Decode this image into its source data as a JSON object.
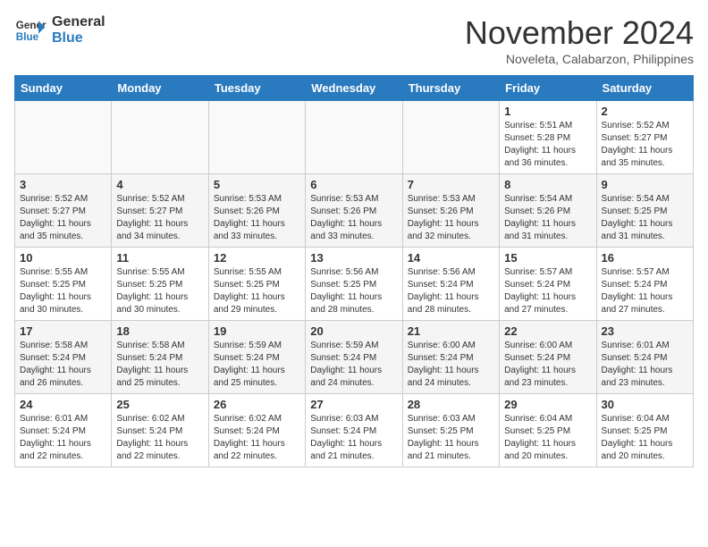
{
  "header": {
    "logo_line1": "General",
    "logo_line2": "Blue",
    "month": "November 2024",
    "location": "Noveleta, Calabarzon, Philippines"
  },
  "weekdays": [
    "Sunday",
    "Monday",
    "Tuesday",
    "Wednesday",
    "Thursday",
    "Friday",
    "Saturday"
  ],
  "weeks": [
    [
      {
        "day": "",
        "info": ""
      },
      {
        "day": "",
        "info": ""
      },
      {
        "day": "",
        "info": ""
      },
      {
        "day": "",
        "info": ""
      },
      {
        "day": "",
        "info": ""
      },
      {
        "day": "1",
        "info": "Sunrise: 5:51 AM\nSunset: 5:28 PM\nDaylight: 11 hours\nand 36 minutes."
      },
      {
        "day": "2",
        "info": "Sunrise: 5:52 AM\nSunset: 5:27 PM\nDaylight: 11 hours\nand 35 minutes."
      }
    ],
    [
      {
        "day": "3",
        "info": "Sunrise: 5:52 AM\nSunset: 5:27 PM\nDaylight: 11 hours\nand 35 minutes."
      },
      {
        "day": "4",
        "info": "Sunrise: 5:52 AM\nSunset: 5:27 PM\nDaylight: 11 hours\nand 34 minutes."
      },
      {
        "day": "5",
        "info": "Sunrise: 5:53 AM\nSunset: 5:26 PM\nDaylight: 11 hours\nand 33 minutes."
      },
      {
        "day": "6",
        "info": "Sunrise: 5:53 AM\nSunset: 5:26 PM\nDaylight: 11 hours\nand 33 minutes."
      },
      {
        "day": "7",
        "info": "Sunrise: 5:53 AM\nSunset: 5:26 PM\nDaylight: 11 hours\nand 32 minutes."
      },
      {
        "day": "8",
        "info": "Sunrise: 5:54 AM\nSunset: 5:26 PM\nDaylight: 11 hours\nand 31 minutes."
      },
      {
        "day": "9",
        "info": "Sunrise: 5:54 AM\nSunset: 5:25 PM\nDaylight: 11 hours\nand 31 minutes."
      }
    ],
    [
      {
        "day": "10",
        "info": "Sunrise: 5:55 AM\nSunset: 5:25 PM\nDaylight: 11 hours\nand 30 minutes."
      },
      {
        "day": "11",
        "info": "Sunrise: 5:55 AM\nSunset: 5:25 PM\nDaylight: 11 hours\nand 30 minutes."
      },
      {
        "day": "12",
        "info": "Sunrise: 5:55 AM\nSunset: 5:25 PM\nDaylight: 11 hours\nand 29 minutes."
      },
      {
        "day": "13",
        "info": "Sunrise: 5:56 AM\nSunset: 5:25 PM\nDaylight: 11 hours\nand 28 minutes."
      },
      {
        "day": "14",
        "info": "Sunrise: 5:56 AM\nSunset: 5:24 PM\nDaylight: 11 hours\nand 28 minutes."
      },
      {
        "day": "15",
        "info": "Sunrise: 5:57 AM\nSunset: 5:24 PM\nDaylight: 11 hours\nand 27 minutes."
      },
      {
        "day": "16",
        "info": "Sunrise: 5:57 AM\nSunset: 5:24 PM\nDaylight: 11 hours\nand 27 minutes."
      }
    ],
    [
      {
        "day": "17",
        "info": "Sunrise: 5:58 AM\nSunset: 5:24 PM\nDaylight: 11 hours\nand 26 minutes."
      },
      {
        "day": "18",
        "info": "Sunrise: 5:58 AM\nSunset: 5:24 PM\nDaylight: 11 hours\nand 25 minutes."
      },
      {
        "day": "19",
        "info": "Sunrise: 5:59 AM\nSunset: 5:24 PM\nDaylight: 11 hours\nand 25 minutes."
      },
      {
        "day": "20",
        "info": "Sunrise: 5:59 AM\nSunset: 5:24 PM\nDaylight: 11 hours\nand 24 minutes."
      },
      {
        "day": "21",
        "info": "Sunrise: 6:00 AM\nSunset: 5:24 PM\nDaylight: 11 hours\nand 24 minutes."
      },
      {
        "day": "22",
        "info": "Sunrise: 6:00 AM\nSunset: 5:24 PM\nDaylight: 11 hours\nand 23 minutes."
      },
      {
        "day": "23",
        "info": "Sunrise: 6:01 AM\nSunset: 5:24 PM\nDaylight: 11 hours\nand 23 minutes."
      }
    ],
    [
      {
        "day": "24",
        "info": "Sunrise: 6:01 AM\nSunset: 5:24 PM\nDaylight: 11 hours\nand 22 minutes."
      },
      {
        "day": "25",
        "info": "Sunrise: 6:02 AM\nSunset: 5:24 PM\nDaylight: 11 hours\nand 22 minutes."
      },
      {
        "day": "26",
        "info": "Sunrise: 6:02 AM\nSunset: 5:24 PM\nDaylight: 11 hours\nand 22 minutes."
      },
      {
        "day": "27",
        "info": "Sunrise: 6:03 AM\nSunset: 5:24 PM\nDaylight: 11 hours\nand 21 minutes."
      },
      {
        "day": "28",
        "info": "Sunrise: 6:03 AM\nSunset: 5:25 PM\nDaylight: 11 hours\nand 21 minutes."
      },
      {
        "day": "29",
        "info": "Sunrise: 6:04 AM\nSunset: 5:25 PM\nDaylight: 11 hours\nand 20 minutes."
      },
      {
        "day": "30",
        "info": "Sunrise: 6:04 AM\nSunset: 5:25 PM\nDaylight: 11 hours\nand 20 minutes."
      }
    ]
  ]
}
